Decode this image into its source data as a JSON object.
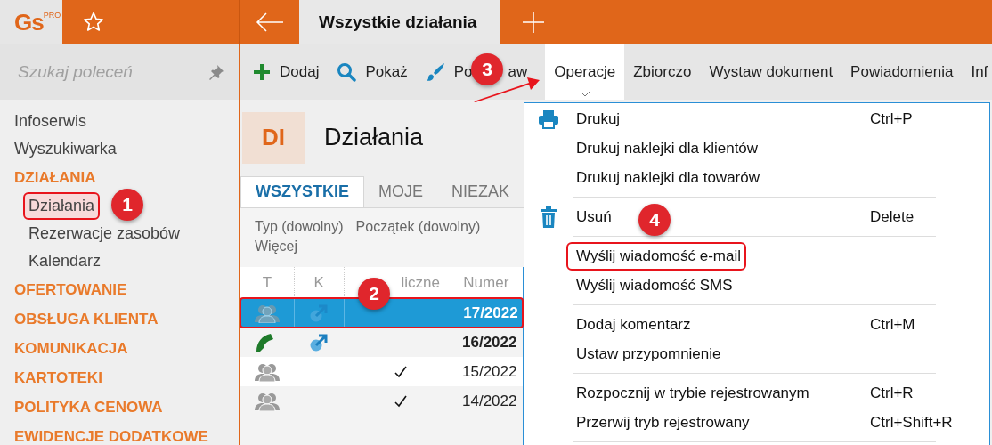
{
  "app": {
    "logo": "Gs",
    "edition": "PRO"
  },
  "open_tab": {
    "title": "Wszystkie działania"
  },
  "sidebar": {
    "search": {
      "placeholder": "Szukaj poleceń"
    },
    "items": [
      {
        "label": "Infoserwis",
        "kind": "link"
      },
      {
        "label": "Wyszukiwarka",
        "kind": "link"
      },
      {
        "label": "DZIAŁANIA",
        "kind": "section",
        "expanded": true,
        "children": [
          {
            "label": "Działania",
            "annotated": true
          },
          {
            "label": "Rezerwacje zasobów",
            "annotated": false
          },
          {
            "label": "Kalendarz",
            "annotated": false
          }
        ]
      },
      {
        "label": "OFERTOWANIE",
        "kind": "section"
      },
      {
        "label": "OBSŁUGA KLIENTA",
        "kind": "section"
      },
      {
        "label": "KOMUNIKACJA",
        "kind": "section"
      },
      {
        "label": "KARTOTEKI",
        "kind": "section"
      },
      {
        "label": "POLITYKA CENOWA",
        "kind": "section"
      },
      {
        "label": "EWIDENCJE DODATKOWE",
        "kind": "section"
      }
    ]
  },
  "toolbar": [
    {
      "label_parts": [
        "Dodaj"
      ]
    },
    {
      "label_parts": [
        "Pokaż"
      ]
    },
    {
      "label_parts": [
        "Po",
        "aw"
      ]
    }
  ],
  "menubar": [
    {
      "label": "Operacje",
      "selected": true
    },
    {
      "label": "Zbiorczo",
      "selected": false
    },
    {
      "label": "Wystaw dokument",
      "selected": false
    },
    {
      "label": "Powiadomienia",
      "selected": false
    },
    {
      "label": "Inf",
      "selected": false
    }
  ],
  "page": {
    "badge": "DI",
    "title": "Działania"
  },
  "view_tabs": [
    {
      "label": "WSZYSTKIE",
      "selected": true
    },
    {
      "label": "MOJE",
      "selected": false
    },
    {
      "label": "NIEZAK",
      "selected": false
    }
  ],
  "filters": [
    "Typ (dowolny)",
    "Początek (dowolny)",
    "Więcej"
  ],
  "table": {
    "columns": [
      "T",
      "K",
      "liczne",
      "Numer"
    ],
    "rows": [
      {
        "kind": "meeting",
        "linked": true,
        "cyclic": false,
        "number": "17/2022",
        "unread": true,
        "selected": true,
        "annotated": true
      },
      {
        "kind": "phone",
        "linked": true,
        "cyclic": false,
        "number": "16/2022",
        "unread": true,
        "selected": false,
        "annotated": false
      },
      {
        "kind": "meeting",
        "linked": false,
        "cyclic": true,
        "number": "15/2022",
        "unread": false,
        "selected": false,
        "annotated": false
      },
      {
        "kind": "meeting",
        "linked": false,
        "cyclic": true,
        "number": "14/2022",
        "unread": false,
        "selected": false,
        "annotated": false
      }
    ]
  },
  "menu": {
    "groups": [
      {
        "items": [
          {
            "label": "Drukuj",
            "shortcut": "Ctrl+P",
            "annotated": false
          },
          {
            "label": "Drukuj naklejki dla klientów",
            "annotated": false
          },
          {
            "label": "Drukuj naklejki dla towarów",
            "annotated": false
          }
        ]
      },
      {
        "items": [
          {
            "label": "Usuń",
            "shortcut": "Delete",
            "annotated": false
          }
        ]
      },
      {
        "items": [
          {
            "label": "Wyślij wiadomość e-mail",
            "annotated": true
          },
          {
            "label": "Wyślij wiadomość SMS",
            "annotated": false
          }
        ]
      },
      {
        "items": [
          {
            "label": "Dodaj komentarz",
            "shortcut": "Ctrl+M",
            "annotated": false
          },
          {
            "label": "Ustaw przypomnienie",
            "annotated": false
          }
        ]
      },
      {
        "items": [
          {
            "label": "Rozpocznij w trybie rejestrowanym",
            "shortcut": "Ctrl+R",
            "annotated": false
          },
          {
            "label": "Przerwij tryb rejestrowany",
            "shortcut": "Ctrl+Shift+R",
            "annotated": false
          }
        ]
      }
    ]
  },
  "annotations": [
    {
      "label": "1"
    },
    {
      "label": "2"
    },
    {
      "label": "3"
    },
    {
      "label": "4"
    }
  ]
}
